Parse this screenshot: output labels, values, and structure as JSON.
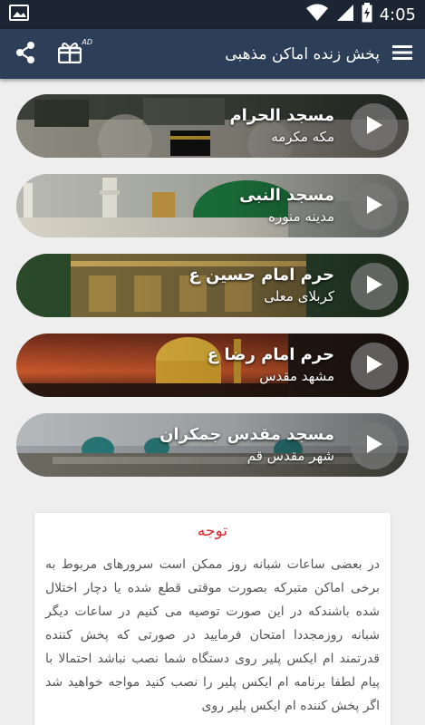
{
  "status_bar": {
    "time": "4:05"
  },
  "app_bar": {
    "title": "پخش زنده اماکن مذهبی",
    "ad_badge": "AD"
  },
  "cards": [
    {
      "title": "مسجد الحرام",
      "subtitle": "مکه مکرمه"
    },
    {
      "title": "مسجد النبی",
      "subtitle": "مدینه منوره"
    },
    {
      "title": "حرم امام حسین ع",
      "subtitle": "کربلای معلی"
    },
    {
      "title": "حرم امام رضا ع",
      "subtitle": "مشهد مقدس"
    },
    {
      "title": "مسجد مقدس جمکران",
      "subtitle": "شهر مقدس قم"
    }
  ],
  "notice": {
    "title": "توجه",
    "body": "در بعضی ساعات شبانه روز ممکن است سرورهای مربوط به برخی اماکن متبرکه بصورت موقتی قطع شده یا دچار اختلال شده باشندکه در این صورت توصیه می کنیم در ساعات دیگر شبانه روزمجددا امتحان فرمایید در صورتی که پخش کننده قدرتمند ام ایکس پلیر روی دستگاه شما نصب نباشد احتمالا با پیام لطفا برنامه ام ایکس پلیر را نصب کنید مواجه خواهید شد اگر پخش کننده ام ایکس پلیر روی"
  },
  "colors": {
    "status_bar": "#1b2533",
    "app_bar": "#2c3e58",
    "background": "#eeeeee",
    "notice_title": "#e0262b"
  }
}
